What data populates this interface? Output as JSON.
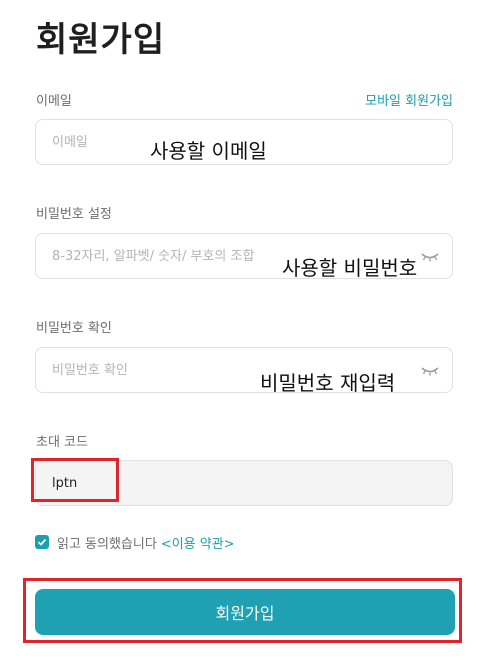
{
  "page": {
    "title": "회원가입"
  },
  "email": {
    "label": "이메일",
    "placeholder": "이메일",
    "mobile_link": "모바일 회원가입",
    "annotation": "사용할 이메일"
  },
  "password": {
    "label": "비밀번호 설정",
    "placeholder": "8-32자리, 알파벳/ 숫자/ 부호의 조합",
    "annotation": "사용할 비밀번호",
    "icon": "eye-hidden-icon"
  },
  "password_confirm": {
    "label": "비밀번호 확인",
    "placeholder": "비밀번호 확인",
    "annotation": "비밀번호 재입력",
    "icon": "eye-hidden-icon"
  },
  "invite": {
    "label": "초대 코드",
    "value": "lptn"
  },
  "agree": {
    "checked": true,
    "text": "읽고 동의했습니다",
    "terms_link": "<이용 약관>"
  },
  "submit": {
    "label": "회원가입"
  },
  "colors": {
    "accent": "#1a9fb0",
    "button": "#1fa0b3",
    "highlight_box": "#e0242b"
  }
}
